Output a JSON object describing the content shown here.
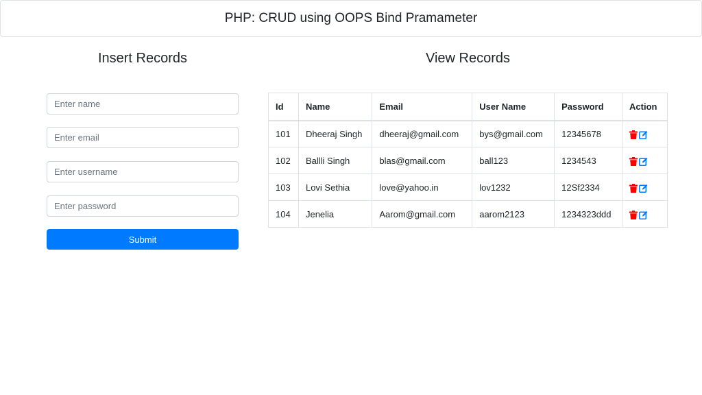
{
  "header": {
    "title": "PHP: CRUD using OOPS Bind Pramameter"
  },
  "insert": {
    "title": "Insert Records",
    "name_placeholder": "Enter name",
    "email_placeholder": "Enter email",
    "username_placeholder": "Enter username",
    "password_placeholder": "Enter password",
    "submit_label": "Submit"
  },
  "view": {
    "title": "View Records",
    "columns": [
      "Id",
      "Name",
      "Email",
      "User Name",
      "Password",
      "Action"
    ],
    "rows": [
      [
        "101",
        "Dheeraj Singh",
        "dheeraj@gmail.com",
        "bys@gmail.com",
        "12345678"
      ],
      [
        "102",
        "Ballli Singh",
        "blas@gmail.com",
        "ball123",
        "1234543"
      ],
      [
        "103",
        "Lovi Sethia",
        "love@yahoo.in",
        "lov1232",
        "12Sf2334"
      ],
      [
        "104",
        "Jenelia",
        "Aarom@gmail.com",
        "aarom2123",
        "1234323ddd"
      ]
    ],
    "action_icons": [
      "trash-icon",
      "edit-icon"
    ]
  },
  "colors": {
    "primary": "#007bff",
    "delete": "#ff0000",
    "edit": "#007bff"
  }
}
